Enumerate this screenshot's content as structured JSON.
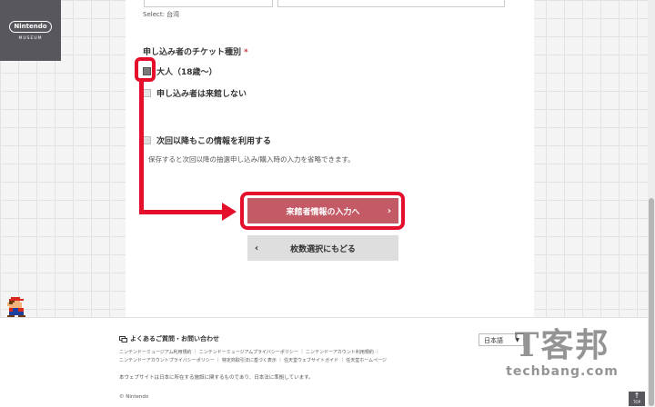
{
  "logo": {
    "brand": "Nintendo",
    "sub": "MUSEUM"
  },
  "form": {
    "select_note": "Select: 台湾",
    "ticket_section": {
      "title": "申し込み者のチケット種別",
      "required_mark": "*"
    },
    "options": [
      {
        "label": "大人（18歳～）",
        "checked": true
      },
      {
        "label": "申し込み者は来館しない",
        "checked": false
      }
    ],
    "save_option": {
      "label": "次回以降もこの情報を利用する",
      "note": "保存すると次回以降の抽選申し込み/購入時の入力を省略できます。"
    },
    "next_button": {
      "label": "来館者情報の入力へ",
      "icon": "chevron-right"
    },
    "back_button": {
      "label": "枚数選択にもどる",
      "icon": "chevron-left"
    }
  },
  "footer": {
    "faq": "よくあるご質問・お問い合わせ",
    "links_row1": "ニンテンドーミュージアム利用規約 ｜ ニンテンドーミュージアムプライバシーポリシー ｜ ニンテンドーアカウント利用規約 ｜",
    "links_row2": "ニンテンドーアカウントプライバシーポリシー ｜ 特定商取引法に基づく表示 ｜ 任天堂ウェブサイトガイド ｜ 任天堂ホームページ",
    "legal": "本ウェブサイトは日本に所在する施設に関するものであり、日本法に準拠しています。",
    "copyright": "© Nintendo",
    "language": "日本語",
    "top_button": "TOP"
  },
  "watermark": {
    "top": "T客邦",
    "bottom": "techbang.com"
  },
  "colors": {
    "highlight": "#e60f2b",
    "next_button": "#c45a66",
    "logo_bg": "#58575d"
  }
}
